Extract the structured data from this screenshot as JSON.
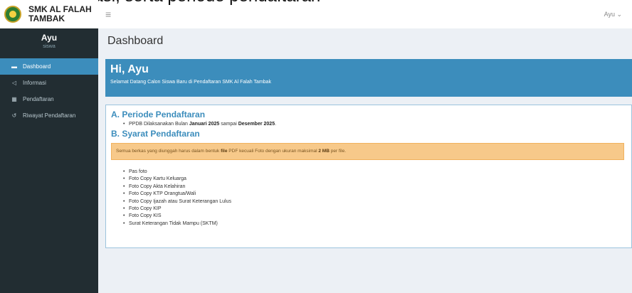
{
  "caption": "Dokumentasi, serta periode pendaftaran",
  "brand": {
    "line1": "SMK AL FALAH",
    "line2": "TAMBAK"
  },
  "topbar": {
    "hamburger": "≡",
    "user_menu": "Ayu ⌄"
  },
  "sidebar": {
    "user_name": "Ayu",
    "user_role": "siswa",
    "items": [
      {
        "label": "Dashboard",
        "icon": "grid-icon",
        "glyph": "▬",
        "active": true
      },
      {
        "label": "Informasi",
        "icon": "megaphone-icon",
        "glyph": "📢",
        "active": false
      },
      {
        "label": "Pendaftaran",
        "icon": "calendar-icon",
        "glyph": "▦",
        "active": false
      },
      {
        "label": "Riwayat Pendaftaran",
        "icon": "history-icon",
        "glyph": "↺",
        "active": false
      }
    ]
  },
  "main": {
    "page_title": "Dashboard",
    "greeting": {
      "title": "Hi, Ayu",
      "subtitle": "Selamat Datang Calon Siswa Baru di Pendaftaran SMK Al Falah Tambak"
    },
    "periode": {
      "title": "A. Periode Pendaftaran",
      "text_prefix": "PPDB Dilaksanakan Bulan ",
      "start": "Januari 2025",
      "text_middle": " sampai ",
      "end": "Desember 2025",
      "text_suffix": "."
    },
    "syarat": {
      "title": "B. Syarat Pendaftaran",
      "warning_prefix": "Semua berkas yang diunggah harus dalam bentuk ",
      "warning_bold1": "file",
      "warning_middle": " PDF kecuali Foto dengan ukuran maksimal ",
      "warning_bold2": "2 MB",
      "warning_suffix": " per file.",
      "items": [
        "Pas foto",
        "Foto Copy Kartu Keluarga",
        "Foto Copy Akta Kelahiran",
        "Foto Copy KTP Orangtua/Wali",
        "Foto Copy Ijazah atau Surat Keterangan Lulus",
        "Foto Copy KIP",
        "Foto Copy KIS",
        "Surat Keterangan Tidak Mampu (SKTM)"
      ]
    }
  },
  "colors": {
    "primary": "#3c8dbc",
    "sidebar_bg": "#222d32",
    "warning_bg": "#f7c98a",
    "content_bg": "#ecf0f5"
  }
}
